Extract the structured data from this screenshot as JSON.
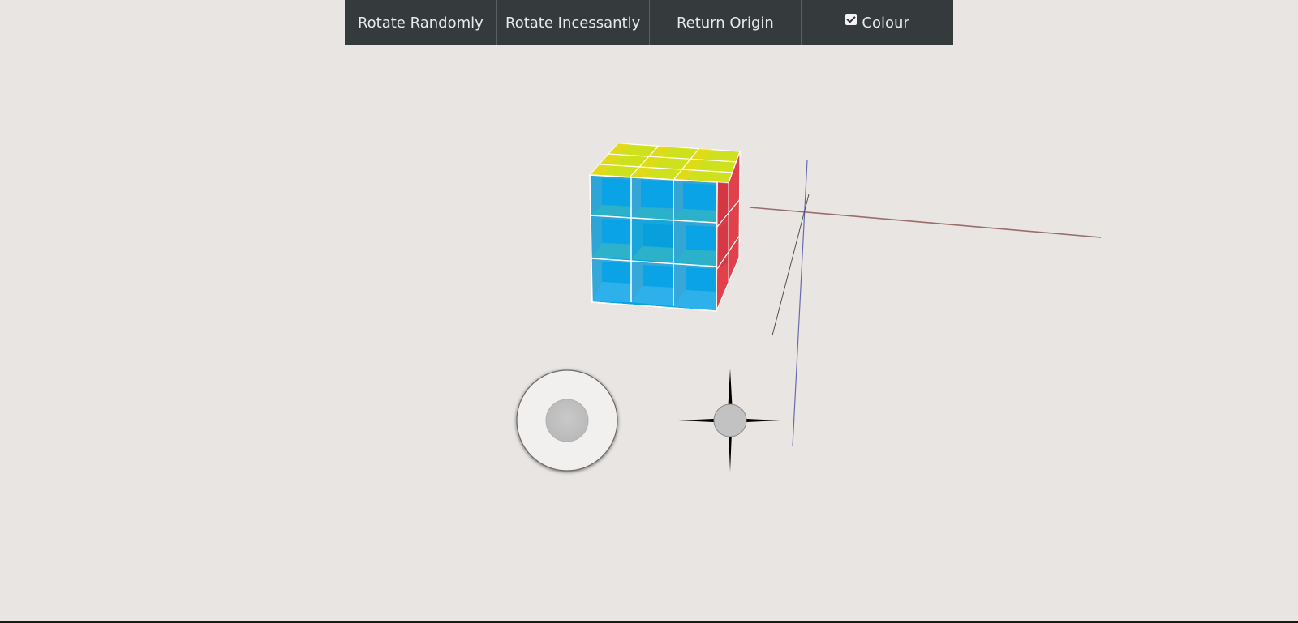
{
  "toolbar": {
    "rotate_randomly": "Rotate Randomly",
    "rotate_incessantly": "Rotate Incessantly",
    "return_origin": "Return Origin",
    "colour": "Colour",
    "colour_checked": true
  },
  "colors": {
    "background": "#e8e5e2",
    "toolbar_bg": "#353a3d",
    "cube_front": "#0aa3e6",
    "cube_top": "#cfe01c",
    "cube_side": "#e0414b",
    "axis_x": "#9a6c6c",
    "axis_y": "#6a6ab0",
    "axis_z": "#444444"
  },
  "icons": {
    "joystick": "joystick-icon",
    "move_cross": "move-cross-icon"
  }
}
